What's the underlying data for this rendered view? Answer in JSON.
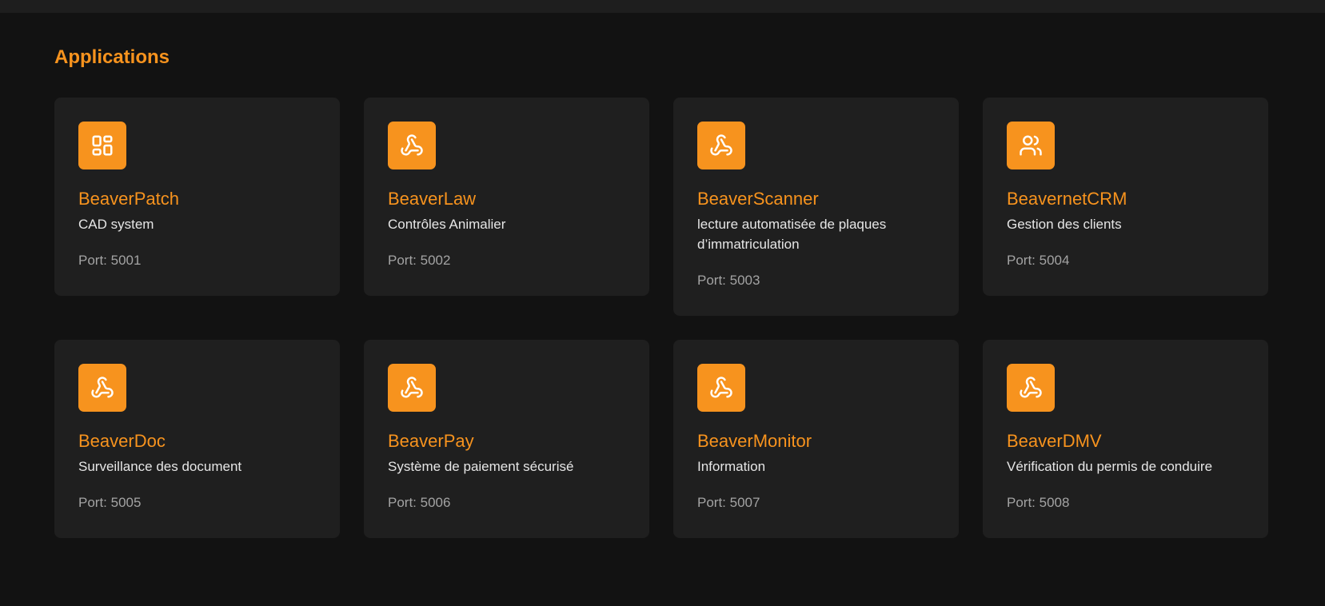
{
  "colors": {
    "accent": "#f7931e",
    "card_bg": "#1f1f1f",
    "page_bg": "#121212"
  },
  "section": {
    "title": "Applications"
  },
  "apps": [
    {
      "name": "BeaverPatch",
      "description": "CAD system",
      "port": "Port: 5001",
      "icon": "grid-icon"
    },
    {
      "name": "BeaverLaw",
      "description": "Contrôles Animalier",
      "port": "Port: 5002",
      "icon": "webhook-icon"
    },
    {
      "name": "BeaverScanner",
      "description": "lecture automatisée de plaques d’immatriculation",
      "port": "Port: 5003",
      "icon": "webhook-icon"
    },
    {
      "name": "BeavernetCRM",
      "description": "Gestion des clients",
      "port": "Port: 5004",
      "icon": "users-icon"
    },
    {
      "name": "BeaverDoc",
      "description": "Surveillance des document",
      "port": "Port: 5005",
      "icon": "webhook-icon"
    },
    {
      "name": "BeaverPay",
      "description": "Système de paiement sécurisé",
      "port": "Port: 5006",
      "icon": "webhook-icon"
    },
    {
      "name": "BeaverMonitor",
      "description": "Information",
      "port": "Port: 5007",
      "icon": "webhook-icon"
    },
    {
      "name": "BeaverDMV",
      "description": "Vérification du permis de conduire",
      "port": "Port: 5008",
      "icon": "webhook-icon"
    }
  ]
}
